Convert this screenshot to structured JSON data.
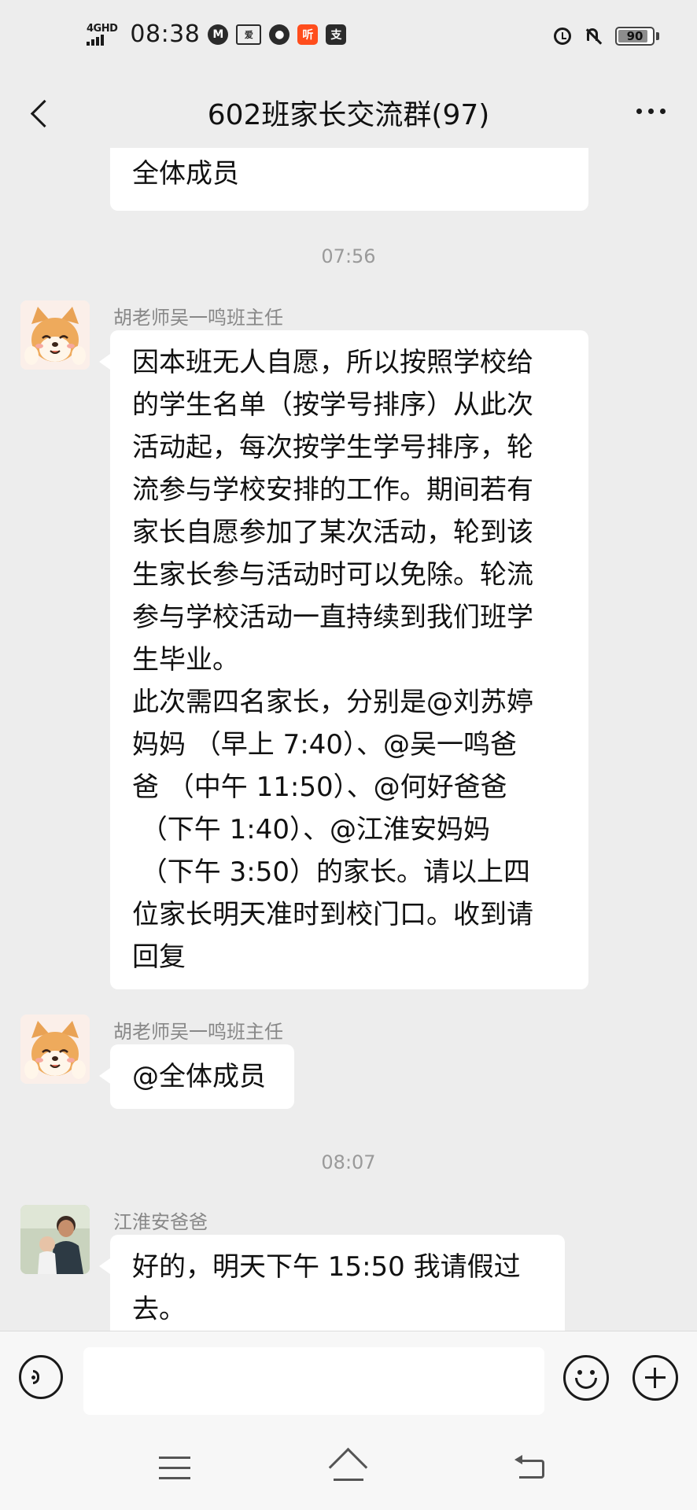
{
  "status_bar": {
    "network": "4GHD",
    "time": "08:38",
    "app_icons": [
      "M",
      "iQIYI",
      "chat",
      "听",
      "支"
    ],
    "battery": "90"
  },
  "title_bar": {
    "title": "602班家长交流群(97)"
  },
  "messages": {
    "partial_top": {
      "text": "全体成员"
    },
    "ts1": "07:56",
    "msg1": {
      "sender": "胡老师吴一鸣班主任",
      "lines": [
        "因本班无人自愿，所以按照学校给",
        "的学生名单（按学号排序）从此次",
        "活动起，每次按学生学号排序，轮",
        "流参与学校安排的工作。期间若有",
        "家长自愿参加了某次活动，轮到该",
        "生家长参与活动时可以免除。轮流",
        "参与学校活动一直持续到我们班学",
        "生毕业。",
        "此次需四名家长，分别是@刘苏婷",
        "妈妈 （早上 7:40）、@吴一鸣爸",
        "爸 （中午 11:50）、@何好爸爸",
        " （下午 1:40）、@江淮安妈妈",
        " （下午 3:50）的家长。请以上四",
        "位家长明天准时到校门口。收到请",
        "回复"
      ]
    },
    "msg2": {
      "sender": "胡老师吴一鸣班主任",
      "text": "@全体成员"
    },
    "ts2": "08:07",
    "msg3": {
      "sender": "江淮安爸爸",
      "lines": [
        "好的，明天下午 15:50 我请假过",
        "去。"
      ]
    }
  },
  "colors": {
    "background": "#ededed",
    "bubble": "#ffffff",
    "meta_text": "#9a9a9a"
  },
  "icons": {
    "back": "back-icon",
    "more": "more-icon",
    "voice": "voice-icon",
    "emoji": "emoji-icon",
    "plus": "plus-icon"
  }
}
